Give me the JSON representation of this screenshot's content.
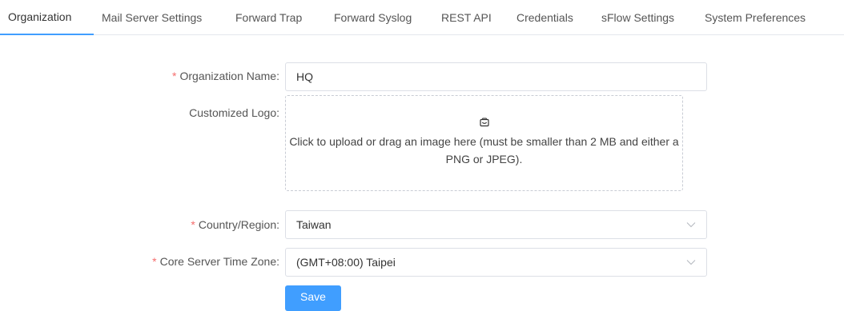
{
  "tabs": [
    {
      "label": "Organization",
      "active": true
    },
    {
      "label": "Mail Server Settings",
      "active": false
    },
    {
      "label": "Forward Trap",
      "active": false
    },
    {
      "label": "Forward Syslog",
      "active": false
    },
    {
      "label": "REST API",
      "active": false
    },
    {
      "label": "Credentials",
      "active": false
    },
    {
      "label": "sFlow Settings",
      "active": false
    },
    {
      "label": "System Preferences",
      "active": false
    }
  ],
  "form": {
    "organization_name": {
      "label": "Organization Name",
      "required_mark": "*",
      "colon": ":",
      "value": "HQ"
    },
    "customized_logo": {
      "label": "Customized Logo",
      "colon": ":",
      "upload_icon": "image-upload-icon",
      "upload_text": "Click to upload or drag an image here (must be smaller than 2 MB and either a PNG or JPEG)."
    },
    "country_region": {
      "label": "Country/Region",
      "required_mark": "*",
      "colon": ":",
      "value": "Taiwan",
      "icon": "chevron-down-icon"
    },
    "time_zone": {
      "label": "Core Server Time Zone",
      "required_mark": "*",
      "colon": ":",
      "value": "(GMT+08:00) Taipei",
      "icon": "chevron-down-icon"
    },
    "save_label": "Save"
  },
  "colors": {
    "accent": "#409eff",
    "required": "#f56c6c",
    "border": "#dcdfe6"
  }
}
